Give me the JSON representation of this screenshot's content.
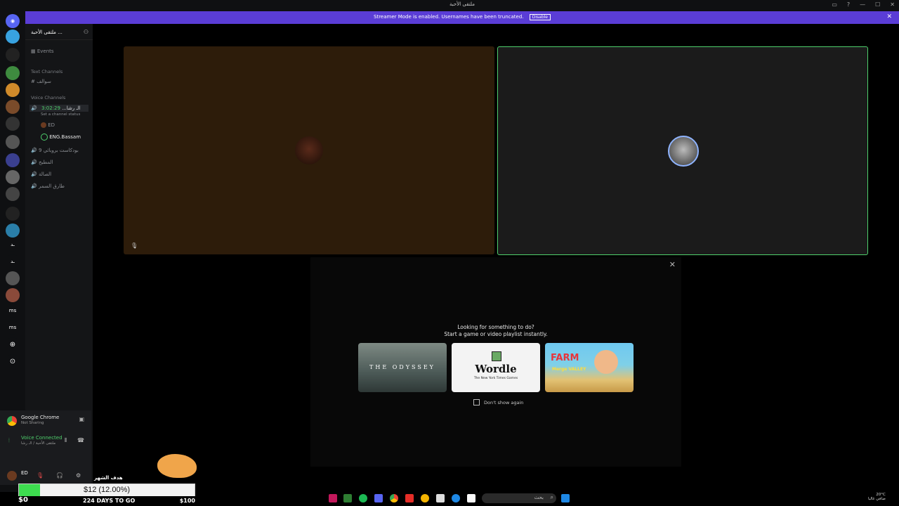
{
  "window": {
    "title": "ملتقى الأحبة",
    "controls": [
      "▭",
      "?",
      "—",
      "☐",
      "✕"
    ]
  },
  "banner": {
    "text": "Streamer Mode is enabled. Usernames have been truncated.",
    "button": "Disable",
    "close": "✕"
  },
  "server": {
    "name": "ملتقى الأحبة ..."
  },
  "sidebar": {
    "events": "Events",
    "text_category": "Text Channels",
    "text_channels": [
      "سوالف"
    ],
    "voice_category": "Voice Channels",
    "active_voice": {
      "name": "الـ رشا...",
      "timer": "3:02:29",
      "status": "Set a channel status"
    },
    "voice_users": [
      "ED",
      "ENG.Bassam"
    ],
    "voice_channels": [
      "بودكاست بروبائي 9",
      "المطبخ",
      "الصالة",
      "طارق السمر"
    ]
  },
  "popup": {
    "line1": "Looking for something to do?",
    "line2": "Start a game or video playlist instantly.",
    "cards": [
      "THE ODYSSEY",
      "Wordle",
      "FARM"
    ],
    "card_subs": [
      "",
      "The New York Times Games",
      "Merge VALLEY"
    ],
    "dont_show": "Don't show again"
  },
  "userpanel": {
    "app": "Google Chrome",
    "app_status": "Not Sharing",
    "voice": "Voice Connected",
    "voice_sub": "ملتقى الأحبة / الـ رشا",
    "user": "ED",
    "goal_label": "هدف الشهر"
  },
  "goal": {
    "amount": "$12 (12.00%)",
    "progress": 0.12,
    "left": "$0",
    "days": "224 DAYS TO GO",
    "right": "$100"
  },
  "taskbar": {
    "search": "بحث",
    "weather": "20°C",
    "time": "صافي غالبا"
  },
  "colors": {
    "accent": "#5a3dd6",
    "speaking": "#4fd06c",
    "goal_fill": "#3ddc4f"
  }
}
